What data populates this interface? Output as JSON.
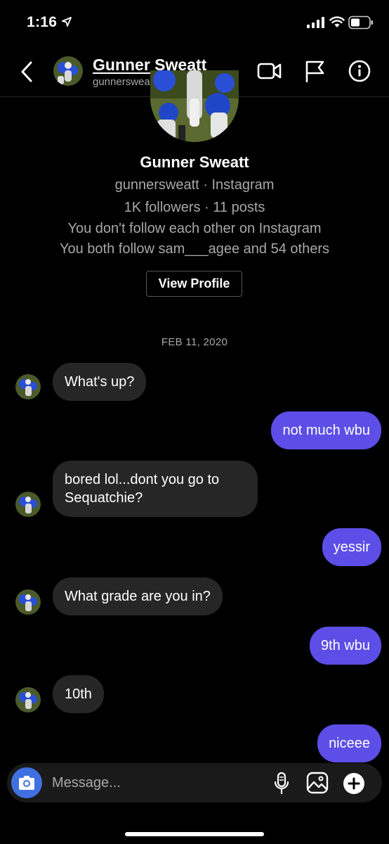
{
  "status_bar": {
    "time": "1:16",
    "icons": [
      "location-arrow-icon",
      "cellular-signal-icon",
      "wifi-icon",
      "battery-icon"
    ]
  },
  "header": {
    "name": "Gunner Sweatt",
    "username": "gunnersweatt",
    "icons": [
      "back-chevron-icon",
      "video-call-icon",
      "flag-icon",
      "info-icon"
    ]
  },
  "profile": {
    "name": "Gunner Sweatt",
    "line1": "gunnersweatt · Instagram",
    "line2": "1K followers · 11 posts",
    "line3": "You don't follow each other on Instagram",
    "line4": "You both follow sam___agee and 54 others",
    "view_profile_label": "View Profile"
  },
  "date": "FEB 11, 2020",
  "messages": [
    {
      "from": "them",
      "text": "What's up?"
    },
    {
      "from": "me",
      "text": "not much wbu"
    },
    {
      "from": "them",
      "text": "bored lol...dont you go to Sequatchie?"
    },
    {
      "from": "me",
      "text": "yessir"
    },
    {
      "from": "them",
      "text": "What grade are you in?"
    },
    {
      "from": "me",
      "text": "9th wbu"
    },
    {
      "from": "them",
      "text": "10th"
    },
    {
      "from": "me",
      "text": "niceee"
    }
  ],
  "composer": {
    "placeholder": "Message...",
    "icons": [
      "camera-icon",
      "microphone-icon",
      "gallery-icon",
      "plus-icon"
    ]
  },
  "colors": {
    "background": "#000000",
    "incoming_bubble": "#262626",
    "outgoing_bubble": "#5c4ee6",
    "secondary_text": "#a8a8a8",
    "camera_button": "#3f6fe0"
  }
}
